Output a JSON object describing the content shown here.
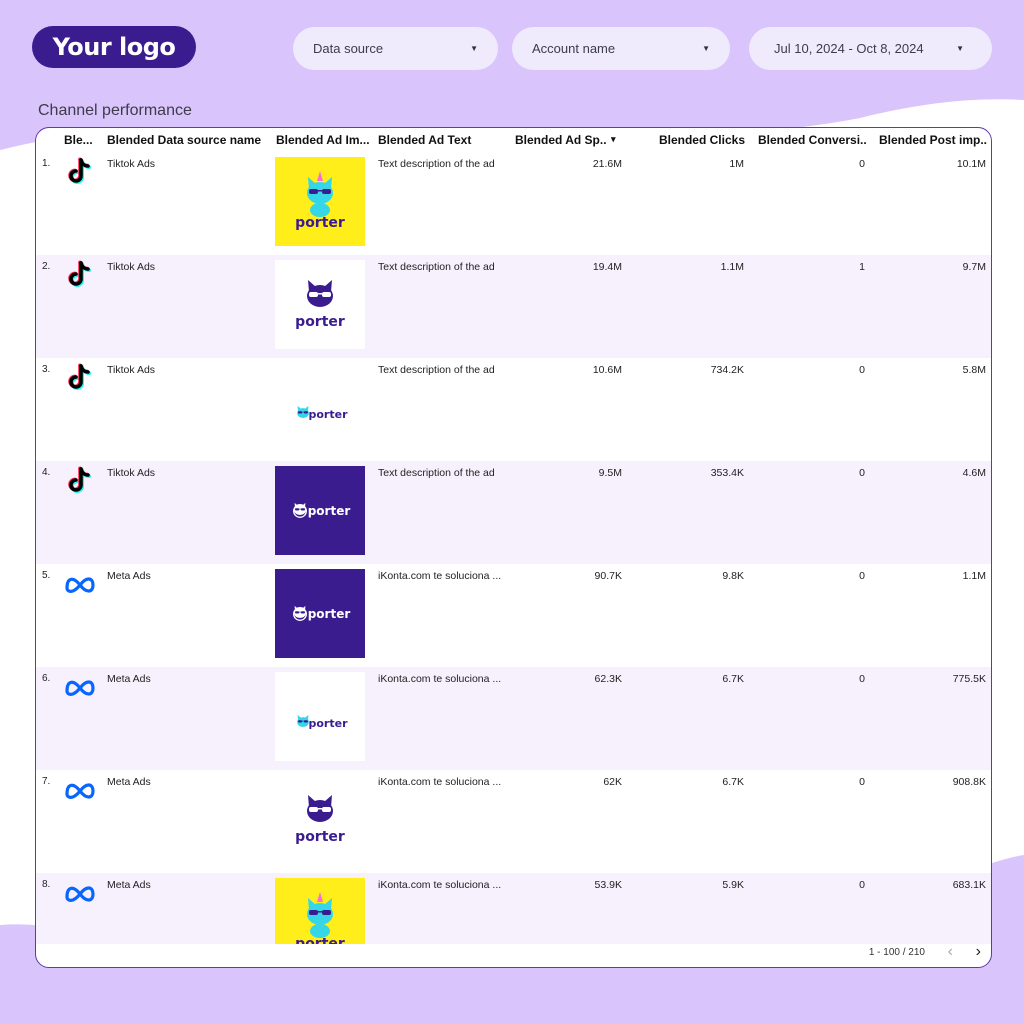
{
  "header": {
    "logo_text": "Your logo",
    "filters": [
      {
        "label": "Data source"
      },
      {
        "label": "Account name"
      },
      {
        "label": "Jul 10, 2024 - Oct 8, 2024"
      }
    ]
  },
  "section_title": "Channel performance",
  "table": {
    "columns": [
      "Ble...",
      "Blended Data source name",
      "Blended Ad Im...",
      "Blended Ad Text",
      "Blended Ad Sp...",
      "Blended Clicks",
      "Blended Conversi...",
      "Blended Post imp..."
    ],
    "sort_indicator": "▾",
    "rows": [
      {
        "idx": "1.",
        "icon": "tiktok-icon",
        "source": "Tiktok Ads",
        "image": "porter-yellow",
        "text": "Text description of the ad",
        "spend": "21.6M",
        "clicks": "1M",
        "conv": "0",
        "imp": "10.1M"
      },
      {
        "idx": "2.",
        "icon": "tiktok-icon",
        "source": "Tiktok Ads",
        "image": "porter-white-stacked",
        "text": "Text description of the ad",
        "spend": "19.4M",
        "clicks": "1.1M",
        "conv": "1",
        "imp": "9.7M"
      },
      {
        "idx": "3.",
        "icon": "tiktok-icon",
        "source": "Tiktok Ads",
        "image": "porter-white-inline",
        "text": "Text description of the ad",
        "spend": "10.6M",
        "clicks": "734.2K",
        "conv": "0",
        "imp": "5.8M"
      },
      {
        "idx": "4.",
        "icon": "tiktok-icon",
        "source": "Tiktok Ads",
        "image": "porter-purple",
        "text": "Text description of the ad",
        "spend": "9.5M",
        "clicks": "353.4K",
        "conv": "0",
        "imp": "4.6M"
      },
      {
        "idx": "5.",
        "icon": "meta-icon",
        "source": "Meta Ads",
        "image": "porter-purple",
        "text": "iKonta.com te soluciona ...",
        "spend": "90.7K",
        "clicks": "9.8K",
        "conv": "0",
        "imp": "1.1M"
      },
      {
        "idx": "6.",
        "icon": "meta-icon",
        "source": "Meta Ads",
        "image": "porter-white-inline",
        "text": "iKonta.com te soluciona ...",
        "spend": "62.3K",
        "clicks": "6.7K",
        "conv": "0",
        "imp": "775.5K"
      },
      {
        "idx": "7.",
        "icon": "meta-icon",
        "source": "Meta Ads",
        "image": "porter-white-stacked",
        "text": "iKonta.com te soluciona ...",
        "spend": "62K",
        "clicks": "6.7K",
        "conv": "0",
        "imp": "908.8K"
      },
      {
        "idx": "8.",
        "icon": "meta-icon",
        "source": "Meta Ads",
        "image": "porter-yellow",
        "text": "iKonta.com te soluciona ...",
        "spend": "53.9K",
        "clicks": "5.9K",
        "conv": "0",
        "imp": "683.1K"
      }
    ],
    "brand_wordmark": "porter",
    "pager": "1 - 100 / 210"
  },
  "colors": {
    "lavender": "#d9c4fb",
    "logo_bg": "#3b1c8f",
    "filter_bg": "#efeafc",
    "row_alt": "#f6f1fd",
    "brand_yellow": "#ffee1a",
    "brand_purple": "#3b1c8f"
  }
}
